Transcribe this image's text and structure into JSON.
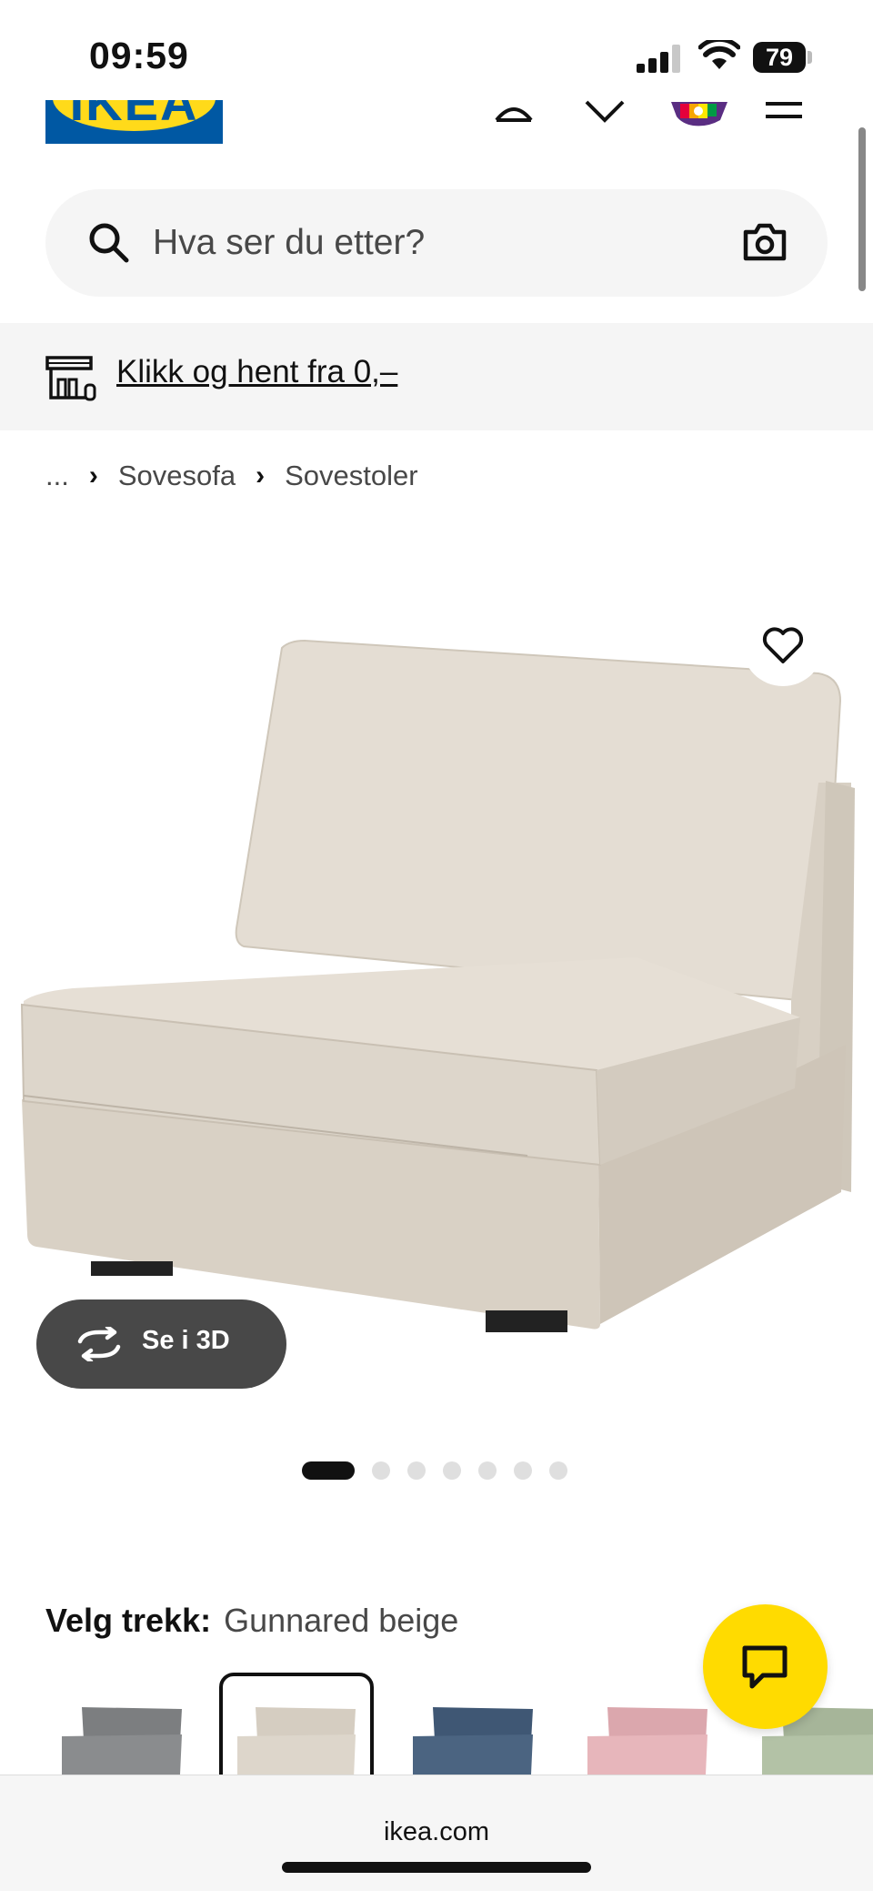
{
  "status_bar": {
    "time": "09:59",
    "battery": "79"
  },
  "header": {
    "logo_text": "IKEA",
    "icons": [
      "profile-icon",
      "chevron-down-icon",
      "cart-icon",
      "menu-icon"
    ]
  },
  "search": {
    "placeholder": "Hva ser du etter?",
    "icons": [
      "search-icon",
      "camera-icon"
    ]
  },
  "banner": {
    "link_label": "Klikk og hent fra 0,–",
    "icon": "store-icon"
  },
  "breadcrumb": {
    "items": [
      "...",
      "Sovesofa",
      "Sovestoler"
    ]
  },
  "product": {
    "favourite_icon": "heart-icon",
    "view_3d_label": "Se i 3D",
    "carousel": {
      "total": 7,
      "active": 1
    }
  },
  "cover": {
    "label": "Velg trekk:",
    "value": "Gunnared beige",
    "swatches": [
      {
        "color": "#8a8c8e",
        "selected": false
      },
      {
        "color": "#ddd6cb",
        "selected": true
      },
      {
        "color": "#4b6481",
        "selected": false
      },
      {
        "color": "#e7b6bb",
        "selected": false
      },
      {
        "color": "#b3c2a6",
        "selected": false
      }
    ]
  },
  "chat": {
    "icon": "chat-icon"
  },
  "browser": {
    "url": "ikea.com"
  },
  "colors": {
    "ikea_blue": "#0058a3",
    "ikea_yellow": "#ffda1a",
    "chat_yellow": "#ffdb00",
    "fabric": "#dcd5c9"
  }
}
